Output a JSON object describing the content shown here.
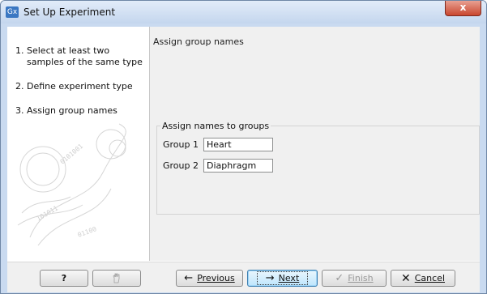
{
  "window": {
    "title": "Set Up Experiment",
    "app_icon_text": "Gx",
    "close_symbol": "x"
  },
  "steps": [
    {
      "num": "1.",
      "label": "Select at least two samples of the same type"
    },
    {
      "num": "2.",
      "label": "Define experiment type"
    },
    {
      "num": "3.",
      "label": "Assign group names"
    }
  ],
  "main": {
    "title": "Assign group names",
    "group_box_title": "Assign names to groups",
    "groups": [
      {
        "label": "Group 1",
        "value": "Heart"
      },
      {
        "label": "Group 2",
        "value": "Diaphragm"
      }
    ]
  },
  "footer": {
    "help_label": "?",
    "previous_label": "Previous",
    "next_label": "Next",
    "finish_label": "Finish",
    "cancel_label": "Cancel"
  },
  "icons": {
    "help": "question-icon",
    "reset": "hand-icon",
    "previous": "arrow-left-icon",
    "next": "arrow-right-icon",
    "finish": "checkmark-icon",
    "cancel": "x-icon"
  }
}
